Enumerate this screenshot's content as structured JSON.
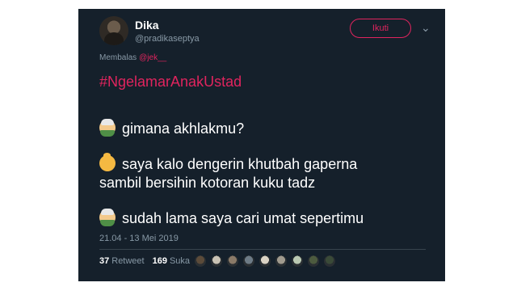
{
  "tweet": {
    "author_name": "Dika",
    "author_handle": "@pradikaseptya",
    "follow_label": "Ikuti",
    "reply_prefix": "Membalas",
    "reply_mention": "@jek__",
    "hashtag": "#NgelamarAnakUstad",
    "lines": [
      {
        "emoji": "older-man-emoji",
        "text": "gimana akhlakmu?"
      },
      {
        "emoji": "baby-emoji",
        "text": "saya kalo dengerin khutbah gaperna"
      },
      {
        "emoji": "",
        "text": "sambil bersihin kotoran kuku tadz"
      },
      {
        "emoji": "older-man-emoji",
        "text": "sudah lama saya cari umat sepertimu"
      }
    ],
    "timestamp": "21.04 - 13 Mei 2019",
    "retweets_count": "37",
    "retweets_label": "Retweet",
    "likes_count": "169",
    "likes_label": "Suka"
  },
  "colors": {
    "background": "#15202b",
    "accent": "#e0245e",
    "muted": "#8899a6"
  },
  "liker_avatars": [
    "#5b4b3a",
    "#c8c2b4",
    "#8a7a68",
    "#6d7b86",
    "#d9d2c4",
    "#a09a8e",
    "#b9c8b2",
    "#4d5b3f",
    "#3a4a38"
  ]
}
